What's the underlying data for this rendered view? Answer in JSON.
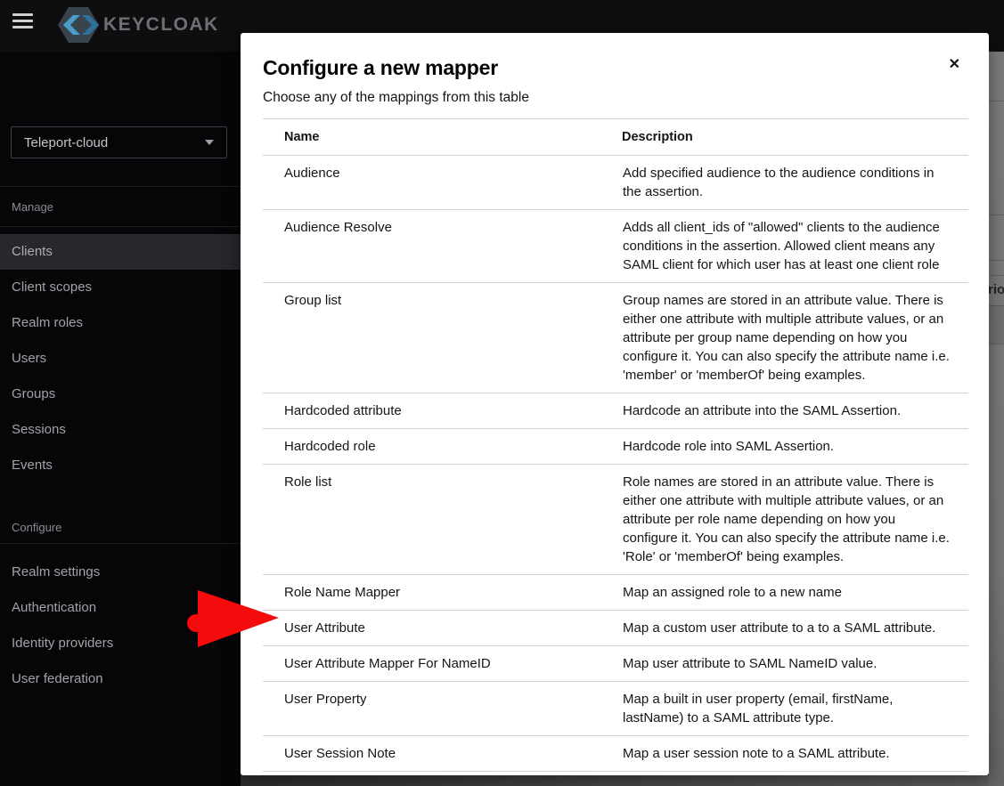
{
  "topbar": {
    "logo_text": "KEYCLOAK"
  },
  "sidebar": {
    "realm_selector": {
      "value": "Teleport-cloud"
    },
    "sections": [
      {
        "label": "Manage",
        "items": [
          {
            "label": "Clients",
            "selected": true
          },
          {
            "label": "Client scopes"
          },
          {
            "label": "Realm roles"
          },
          {
            "label": "Users"
          },
          {
            "label": "Groups"
          },
          {
            "label": "Sessions"
          },
          {
            "label": "Events"
          }
        ]
      },
      {
        "label": "Configure",
        "items": [
          {
            "label": "Realm settings"
          },
          {
            "label": "Authentication"
          },
          {
            "label": "Identity providers"
          },
          {
            "label": "User federation"
          }
        ]
      }
    ]
  },
  "modal": {
    "title": "Configure a new mapper",
    "subtitle": "Choose any of the mappings from this table",
    "close_icon": "✕",
    "table": {
      "columns": [
        "Name",
        "Description"
      ],
      "rows": [
        {
          "name": "Audience",
          "description": "Add specified audience to the audience conditions in the assertion."
        },
        {
          "name": "Audience Resolve",
          "description": "Adds all client_ids of \"allowed\" clients to the audience conditions in the assertion. Allowed client means any SAML client for which user has at least one client role"
        },
        {
          "name": "Group list",
          "description": "Group names are stored in an attribute value. There is either one attribute with multiple attribute values, or an attribute per group name depending on how you configure it. You can also specify the attribute name i.e. 'member' or 'memberOf' being examples."
        },
        {
          "name": "Hardcoded attribute",
          "description": "Hardcode an attribute into the SAML Assertion."
        },
        {
          "name": "Hardcoded role",
          "description": "Hardcode role into SAML Assertion."
        },
        {
          "name": "Role list",
          "description": "Role names are stored in an attribute value. There is either one attribute with multiple attribute values, or an attribute per role name depending on how you configure it. You can also specify the attribute name i.e. 'Role' or 'memberOf' being examples."
        },
        {
          "name": "Role Name Mapper",
          "description": "Map an assigned role to a new name"
        },
        {
          "name": "User Attribute",
          "description": "Map a custom user attribute to a to a SAML attribute."
        },
        {
          "name": "User Attribute Mapper For NameID",
          "description": "Map user attribute to SAML NameID value."
        },
        {
          "name": "User Property",
          "description": "Map a built in user property (email, firstName, lastName) to a SAML attribute type."
        },
        {
          "name": "User Session Note",
          "description": "Map a user session note to a SAML attribute."
        }
      ]
    }
  },
  "background_page": {
    "visible_text_fragment": "rio"
  },
  "annotation": {
    "arrow_color": "#f40b0b",
    "arrow_target": "User Attribute"
  },
  "colors": {
    "keycloak_blue_light": "#4a9fca",
    "keycloak_blue_dark": "#2e6f9e",
    "sidebar_selected_bg": "#26282e",
    "table_border": "#d2d2d2"
  }
}
